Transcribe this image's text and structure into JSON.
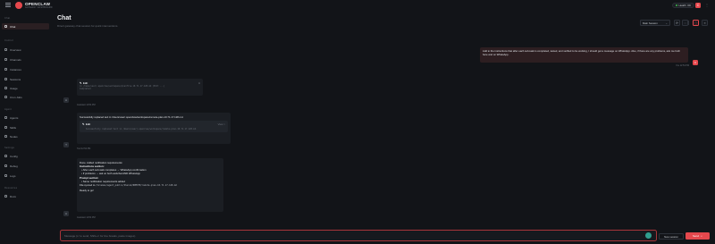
{
  "app": {
    "brand": "OPENCLAW",
    "brand_sub": "GATEWAY DASHBOARD",
    "health_label": "Health",
    "health_status": "OK",
    "avatar_initial": "C",
    "more_icon": "more-icon"
  },
  "sidebar": {
    "sections": [
      {
        "title": "Chat",
        "items": [
          {
            "label": "Chat",
            "icon": "chat-icon",
            "active": true
          }
        ]
      },
      {
        "title": "Control",
        "items": [
          {
            "label": "Overview",
            "icon": "overview-icon"
          },
          {
            "label": "Channels",
            "icon": "channels-icon"
          },
          {
            "label": "Instances",
            "icon": "instances-icon"
          },
          {
            "label": "Sessions",
            "icon": "sessions-icon"
          },
          {
            "label": "Usage",
            "icon": "usage-icon"
          },
          {
            "label": "Cron Jobs",
            "icon": "cron-icon"
          }
        ]
      },
      {
        "title": "Agent",
        "items": [
          {
            "label": "Agents",
            "icon": "agents-icon"
          },
          {
            "label": "Skills",
            "icon": "skills-icon"
          },
          {
            "label": "Nodes",
            "icon": "nodes-icon"
          }
        ]
      },
      {
        "title": "Settings",
        "items": [
          {
            "label": "Config",
            "icon": "config-icon"
          },
          {
            "label": "Debug",
            "icon": "debug-icon"
          },
          {
            "label": "Logs",
            "icon": "logs-icon"
          }
        ]
      },
      {
        "title": "Resources",
        "items": [
          {
            "label": "Docs",
            "icon": "docs-icon"
          }
        ]
      }
    ]
  },
  "header": {
    "title": "Chat",
    "subtitle": "Direct gateway chat session for quick interventions.",
    "session_select": "Main Session"
  },
  "messages": {
    "user": {
      "text": "Add to the instructions that after each sub-task is completed, tested, and verified to be working, I should get a message on WhatsApp. Also, if there are any problems, ask me both here and on WhatsApp.",
      "meta": "You  12:54 PM",
      "avatar": "C"
    },
    "tool1": {
      "name": "Edit",
      "path": "in /home/user/.openclaw/workspace/planfile-10.71.17.128.md  (Edit ...)",
      "completed": "Completed",
      "meta": "Assistant  12:54 PM",
      "avatar": "A"
    },
    "tool2": {
      "result": "Successfully replaced text in /Users/user/.openclaw/workspace/remote-plan-10.71.17.128.md.",
      "name": "Edit",
      "view": "View >",
      "path": "Successfully replaced text in /Users/user/.openclaw/workspace/remote-plan-10.71.17.128.md.",
      "meta": "Tool  12:54 PM",
      "avatar": "T"
    },
    "reply": {
      "intro": "Done. Added notification requirements:",
      "h1": "Instructions section:",
      "b1": "After each sub-task completes → WhatsApp confirmation",
      "b2": "If problems → ask on both webchat AND WhatsApp",
      "h2": "Prompt section:",
      "b3": "Same notification requirements added",
      "file_prefix": "File synced to",
      "file_path": "/Volumes/agent_public/Shared/REMOTE/remote-plan-10.71.17.128.md",
      "outro": "Ready to go!",
      "meta": "Assistant  12:54 PM",
      "avatar": "A"
    }
  },
  "composer": {
    "placeholder": "Message (↩ to send, Shift+↩ for line breaks, paste images)",
    "new_session": "New session",
    "send": "Send",
    "send_key": "↵"
  }
}
